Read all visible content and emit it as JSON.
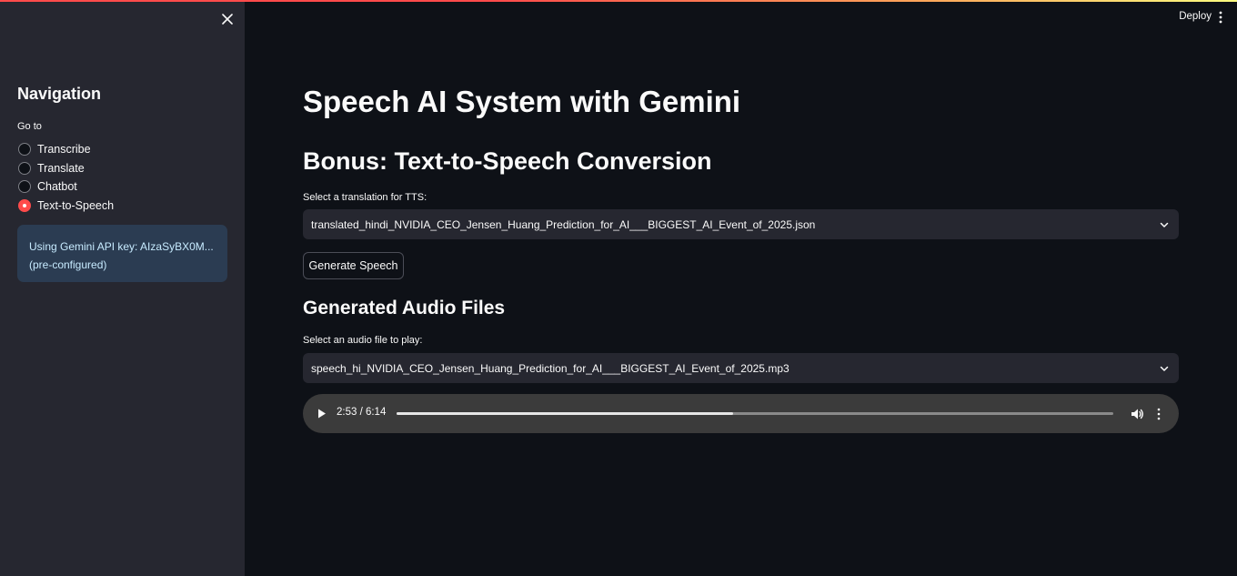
{
  "header": {
    "deploy_label": "Deploy"
  },
  "sidebar": {
    "title": "Navigation",
    "radio_label": "Go to",
    "options": [
      {
        "label": "Transcribe",
        "selected": false
      },
      {
        "label": "Translate",
        "selected": false
      },
      {
        "label": "Chatbot",
        "selected": false
      },
      {
        "label": "Text-to-Speech",
        "selected": true
      }
    ],
    "info_line1": "Using Gemini API key: AIzaSyBX0M...",
    "info_line2": "(pre-configured)"
  },
  "main": {
    "title": "Speech AI System with Gemini",
    "section_title": "Bonus: Text-to-Speech Conversion",
    "translation_select": {
      "label": "Select a translation for TTS:",
      "value": "translated_hindi_NVIDIA_CEO_Jensen_Huang_Prediction_for_AI___BIGGEST_AI_Event_of_2025.json"
    },
    "generate_button": "Generate Speech",
    "audio_section_title": "Generated Audio Files",
    "audio_select": {
      "label": "Select an audio file to play:",
      "value": "speech_hi_NVIDIA_CEO_Jensen_Huang_Prediction_for_AI___BIGGEST_AI_Event_of_2025.mp3"
    },
    "player": {
      "time": "2:53 / 6:14",
      "progress": 0.47
    }
  },
  "colors": {
    "accent": "#ff4b4b",
    "background": "#0e1117",
    "sidebar": "#262730",
    "info_bg": "#2b3c52",
    "info_text": "#c7ebff"
  }
}
